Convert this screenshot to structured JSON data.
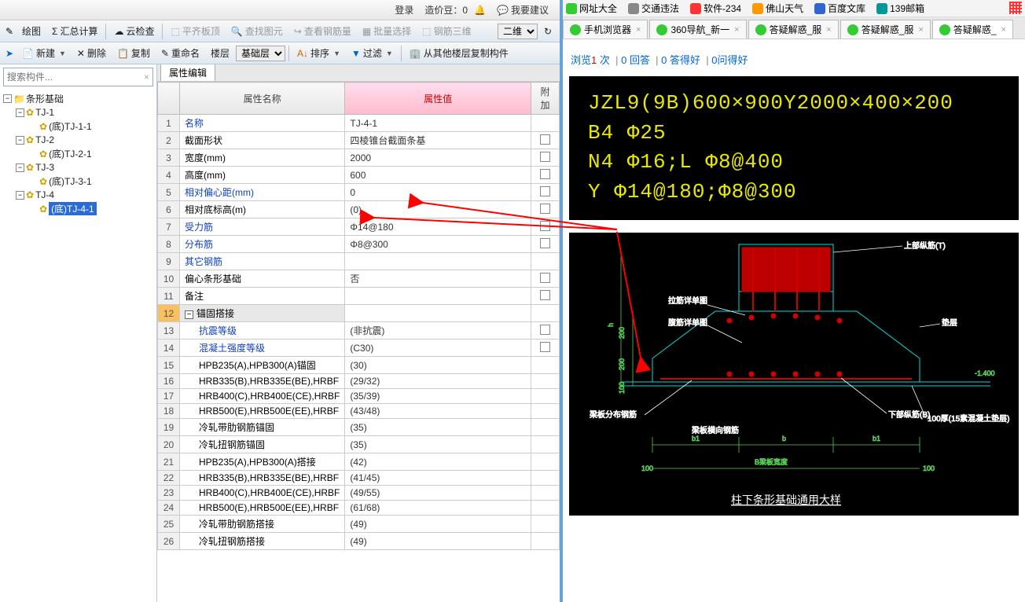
{
  "topbar": {
    "login": "登录",
    "coin_label": "造价豆：",
    "coin_value": "0",
    "suggest": "我要建议"
  },
  "toolbar1": {
    "draw": "绘图",
    "sum": "汇总计算",
    "cloud": "云检查",
    "flat": "平齐板顶",
    "find": "查找图元",
    "info": "查看钢筋量",
    "batch": "批量选择",
    "rebar3d": "钢筋三维",
    "view2d": "二维"
  },
  "toolbar2": {
    "new": "新建",
    "del": "删除",
    "copy": "复制",
    "rename": "重命名",
    "floor": "楼层",
    "layer_value": "基础层",
    "sort": "排序",
    "filter": "过滤",
    "copyfrom": "从其他楼层复制构件"
  },
  "search_placeholder": "搜索构件...",
  "tree": {
    "root": "条形基础",
    "nodes": [
      {
        "name": "TJ-1",
        "children": [
          "(底)TJ-1-1"
        ]
      },
      {
        "name": "TJ-2",
        "children": [
          "(底)TJ-2-1"
        ]
      },
      {
        "name": "TJ-3",
        "children": [
          "(底)TJ-3-1"
        ]
      },
      {
        "name": "TJ-4",
        "children": [
          "(底)TJ-4-1"
        ]
      }
    ],
    "selected": "(底)TJ-4-1"
  },
  "prop_tab": "属性编辑",
  "prop_headers": {
    "name": "属性名称",
    "value": "属性值",
    "extra": "附加"
  },
  "props": [
    {
      "n": "1",
      "name": "名称",
      "val": "TJ-4-1",
      "link": true,
      "chk": false
    },
    {
      "n": "2",
      "name": "截面形状",
      "val": "四棱锥台截面条基",
      "link": false,
      "chk": true
    },
    {
      "n": "3",
      "name": "宽度(mm)",
      "val": "2000",
      "link": false,
      "chk": true
    },
    {
      "n": "4",
      "name": "高度(mm)",
      "val": "600",
      "link": false,
      "chk": true
    },
    {
      "n": "5",
      "name": "相对偏心距(mm)",
      "val": "0",
      "link": true,
      "chk": true
    },
    {
      "n": "6",
      "name": "相对底标高(m)",
      "val": "(0)",
      "link": false,
      "chk": true
    },
    {
      "n": "7",
      "name": "受力筋",
      "val": "Φ14@180",
      "link": true,
      "chk": true
    },
    {
      "n": "8",
      "name": "分布筋",
      "val": "Φ8@300",
      "link": true,
      "chk": true
    },
    {
      "n": "9",
      "name": "其它钢筋",
      "val": "",
      "link": true,
      "chk": false
    },
    {
      "n": "10",
      "name": "偏心条形基础",
      "val": "否",
      "link": false,
      "chk": true
    },
    {
      "n": "11",
      "name": "备注",
      "val": "",
      "link": false,
      "chk": true
    },
    {
      "n": "12",
      "name": "锚固搭接",
      "val": "",
      "group": true,
      "sel": true
    },
    {
      "n": "13",
      "name": "抗震等级",
      "val": "(非抗震)",
      "link": true,
      "chk": true,
      "indent": 1
    },
    {
      "n": "14",
      "name": "混凝土强度等级",
      "val": "(C30)",
      "link": true,
      "chk": true,
      "indent": 1
    },
    {
      "n": "15",
      "name": "HPB235(A),HPB300(A)锚固",
      "val": "(30)",
      "indent": 1
    },
    {
      "n": "16",
      "name": "HRB335(B),HRB335E(BE),HRBF",
      "val": "(29/32)",
      "indent": 1
    },
    {
      "n": "17",
      "name": "HRB400(C),HRB400E(CE),HRBF",
      "val": "(35/39)",
      "indent": 1
    },
    {
      "n": "18",
      "name": "HRB500(E),HRB500E(EE),HRBF",
      "val": "(43/48)",
      "indent": 1
    },
    {
      "n": "19",
      "name": "冷轧带肋钢筋锚固",
      "val": "(35)",
      "indent": 1
    },
    {
      "n": "20",
      "name": "冷轧扭钢筋锚固",
      "val": "(35)",
      "indent": 1
    },
    {
      "n": "21",
      "name": "HPB235(A),HPB300(A)搭接",
      "val": "(42)",
      "indent": 1
    },
    {
      "n": "22",
      "name": "HRB335(B),HRB335E(BE),HRBF",
      "val": "(41/45)",
      "indent": 1
    },
    {
      "n": "23",
      "name": "HRB400(C),HRB400E(CE),HRBF",
      "val": "(49/55)",
      "indent": 1
    },
    {
      "n": "24",
      "name": "HRB500(E),HRB500E(EE),HRBF",
      "val": "(61/68)",
      "indent": 1
    },
    {
      "n": "25",
      "name": "冷轧带肋钢筋搭接",
      "val": "(49)",
      "indent": 1
    },
    {
      "n": "26",
      "name": "冷轧扭钢筋搭接",
      "val": "(49)",
      "indent": 1
    }
  ],
  "bookmarks": [
    {
      "icon": "green",
      "label": "网址大全"
    },
    {
      "icon": "plain",
      "label": "交通违法"
    },
    {
      "icon": "red",
      "label": "软件-234"
    },
    {
      "icon": "orange",
      "label": "佛山天气"
    },
    {
      "icon": "blue",
      "label": "百度文库"
    },
    {
      "icon": "teal",
      "label": "139邮箱"
    }
  ],
  "browser_tabs": [
    {
      "label": "手机浏览器",
      "active": false
    },
    {
      "label": "360导航_新一",
      "active": false
    },
    {
      "label": "答疑解惑_服",
      "active": false
    },
    {
      "label": "答疑解惑_服",
      "active": false
    },
    {
      "label": "答疑解惑_",
      "active": true
    }
  ],
  "stats": {
    "views_label": "浏览",
    "views": "1",
    "times": "次",
    "answers": "0 回答",
    "good_ans": "0 答得好",
    "good_q": "0问得好"
  },
  "cad_lines": [
    "JZL9(9B)600×900Y2000×400×200",
    "B4 Φ25",
    "N4 Φ16;L Φ8@400",
    "Y Φ14@180;Φ8@300"
  ],
  "diagram_title": "柱下条形基础通用大样",
  "diagram_labels": {
    "top_bar": "上部纵筋(T)",
    "lift_ring": "拉筋详单图",
    "stirrup": "腹筋详单图",
    "slab": "垫层",
    "dist_rebar": "梁板分布钢筋",
    "bottom_bar": "下部纵筋(B)",
    "note_100": "100厚(15素混凝土垫层)",
    "transverse": "梁板横向钢筋",
    "width_b": "B梁板宽度",
    "h": "h",
    "d200a": "200",
    "d200b": "200",
    "d100a": "100",
    "d100b": "100",
    "d100c": "100",
    "elev": "-1.400",
    "b1": "b1",
    "b": "b",
    "b2": "b1"
  }
}
